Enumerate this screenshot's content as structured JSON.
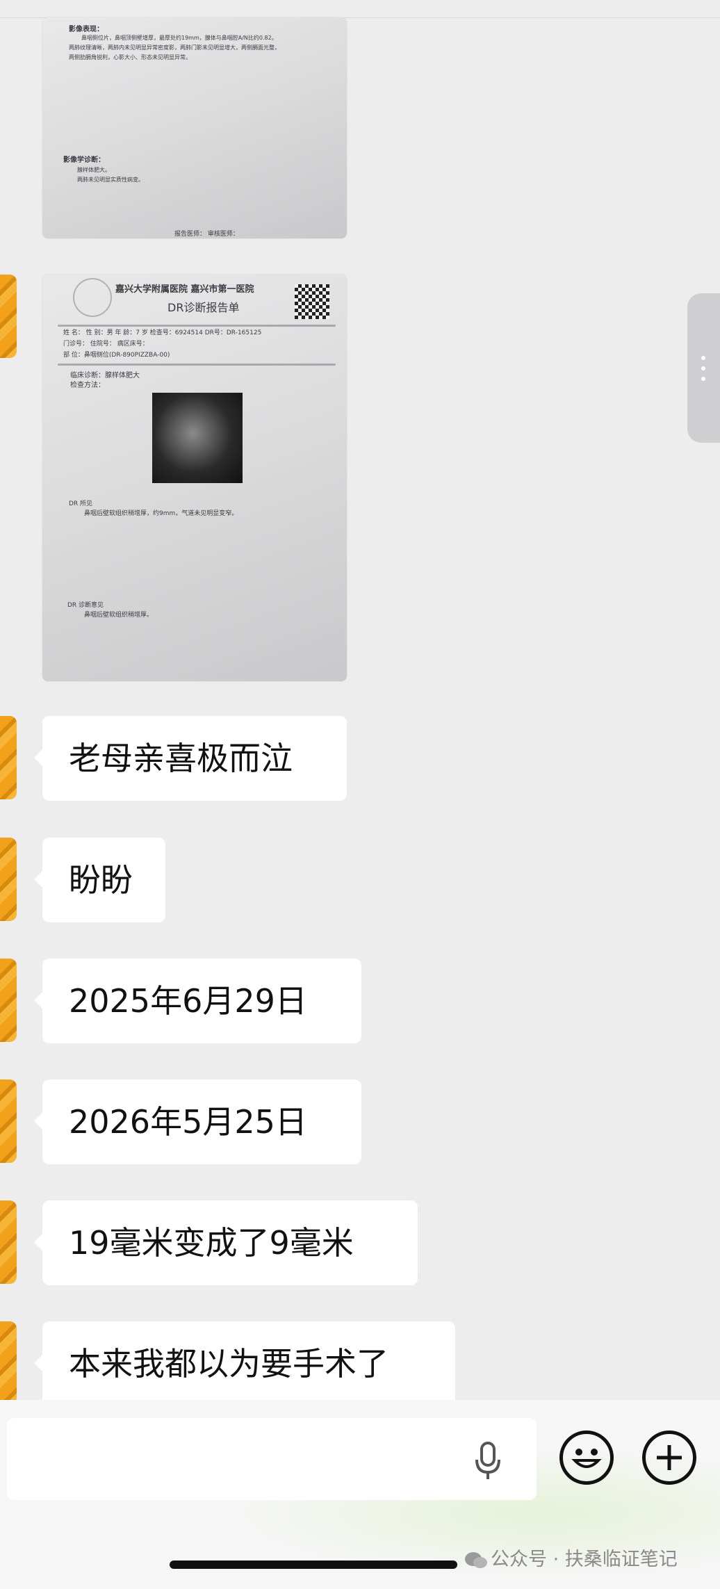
{
  "messages": [
    {
      "type": "image",
      "description_label": "report-photo-1"
    },
    {
      "type": "image",
      "description_label": "report-photo-2"
    },
    {
      "type": "text",
      "text": "老母亲喜极而泣"
    },
    {
      "type": "text",
      "text": "盼盼"
    },
    {
      "type": "text",
      "text": "2025年6月29日"
    },
    {
      "type": "text",
      "text": "2026年5月25日"
    },
    {
      "type": "text",
      "text": "19毫米变成了9毫米"
    },
    {
      "type": "text",
      "text": "本来我都以为要手术了"
    }
  ],
  "report1": {
    "findings_heading": "影像表现：",
    "finding_line1": "鼻咽侧位片，鼻咽顶侧壁增厚，最厚处约19mm，腺体与鼻咽腔A/N比约0.82。",
    "finding_line2": "两肺纹理清晰，两肺内未见明显异常密度影，两肺门影未见明显增大，两侧膈面光整，",
    "finding_line3": "两侧肋膈角锐利，心影大小、形态未见明显异常。",
    "impression_heading": "影像学诊断：",
    "impression_line1": "腺样体肥大。",
    "impression_line2": "两肺未见明显实质性病变。",
    "footer": "报告医师：      审核医师："
  },
  "report2": {
    "hospital": "嘉兴大学附属医院 嘉兴市第一医院",
    "title": "DR诊断报告单",
    "row1": "姓  名：      性 别：男    年  龄：7 岁 检查号：6924514    DR号：DR-165125",
    "row2": "门诊号：                住院号：               病区床号：",
    "row3": "部  位：鼻咽侧位(DR-890PIZZBA-00)",
    "clinical": "临床诊断：腺样体肥大",
    "method": "检查方法：",
    "findings_heading": "DR 所见",
    "finding_line1": "鼻咽后壁软组织稍增厚，约9mm，气道未见明显变窄。",
    "impression_heading": "DR 诊断意见",
    "impression_line1": "鼻咽后壁软组织稍增厚。"
  },
  "watermark": "公众号 · 扶桑临证笔记",
  "colors": {
    "background": "#ededed",
    "bubble": "#ffffff",
    "avatar": "#f1a21a"
  }
}
